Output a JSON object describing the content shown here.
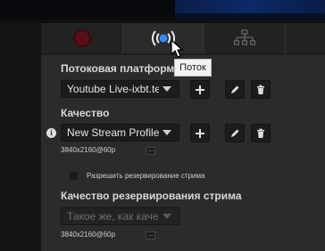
{
  "tabs": [
    {
      "id": "record",
      "icon": "record-dot-icon"
    },
    {
      "id": "stream",
      "icon": "broadcast-icon",
      "active": true
    },
    {
      "id": "network",
      "icon": "network-icon"
    }
  ],
  "tooltip": {
    "text": "Поток"
  },
  "platform": {
    "label": "Потоковая платформа",
    "selected": "Youtube Live-ixbt.te"
  },
  "quality": {
    "label": "Качество",
    "selected": "New Stream Profile",
    "resolution": "3840x2160@60p"
  },
  "backup": {
    "checkbox_label": "Разрешить резервирование стрима",
    "checked": false
  },
  "backup_quality": {
    "label": "Качество резервирования стрима",
    "selected": "Такое же, как качес",
    "resolution": "3840x2160@60p"
  },
  "dots_label": "...",
  "colors": {
    "accent_blue": "#2d8cff",
    "record_red": "#5a0f16",
    "panel_bg": "#2b2b2b"
  }
}
